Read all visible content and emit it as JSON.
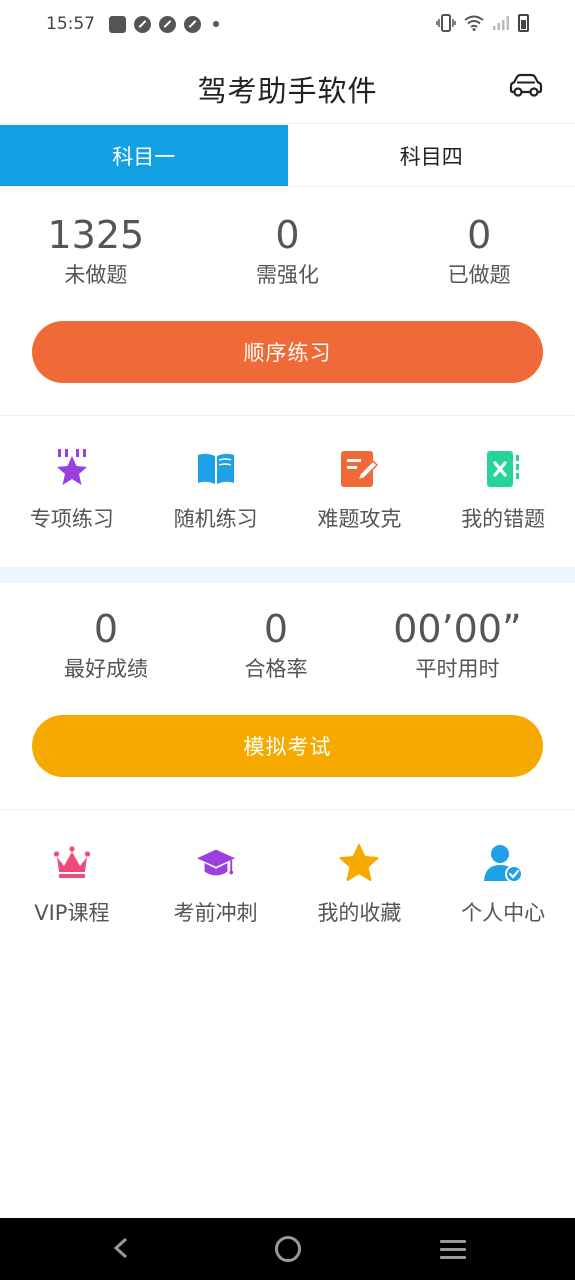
{
  "status_bar": {
    "time": "15:57"
  },
  "header": {
    "title": "驾考助手软件",
    "car_icon": "car-icon"
  },
  "tabs": [
    {
      "label": "科目一",
      "active": true
    },
    {
      "label": "科目四",
      "active": false
    }
  ],
  "practice": {
    "stats": [
      {
        "value": "1325",
        "label": "未做题"
      },
      {
        "value": "0",
        "label": "需强化"
      },
      {
        "value": "0",
        "label": "已做题"
      }
    ],
    "button_label": "顺序练习",
    "button_color": "#ef6a36"
  },
  "practice_menu": [
    {
      "label": "专项练习",
      "icon": "star-badge-icon",
      "color": "#9b3fe0"
    },
    {
      "label": "随机练习",
      "icon": "open-book-icon",
      "color": "#1ea1e6"
    },
    {
      "label": "难题攻克",
      "icon": "edit-note-icon",
      "color": "#ef6a36"
    },
    {
      "label": "我的错题",
      "icon": "wrong-answer-icon",
      "color": "#26d39a"
    }
  ],
  "exam": {
    "stats": [
      {
        "value": "0",
        "label": "最好成绩"
      },
      {
        "value": "0",
        "label": "合格率"
      },
      {
        "value": "00’00”",
        "label": "平时用时"
      }
    ],
    "button_label": "模拟考试",
    "button_color": "#f6aa00"
  },
  "more_menu": [
    {
      "label": "VIP课程",
      "icon": "crown-icon",
      "color": "#f04a7a"
    },
    {
      "label": "考前冲刺",
      "icon": "graduation-cap-icon",
      "color": "#9b3fe0"
    },
    {
      "label": "我的收藏",
      "icon": "star-icon",
      "color": "#f6aa00"
    },
    {
      "label": "个人中心",
      "icon": "user-check-icon",
      "color": "#1ea1e6"
    }
  ],
  "colors": {
    "tab_active": "#12a0e3",
    "band": "#eef5fb"
  }
}
